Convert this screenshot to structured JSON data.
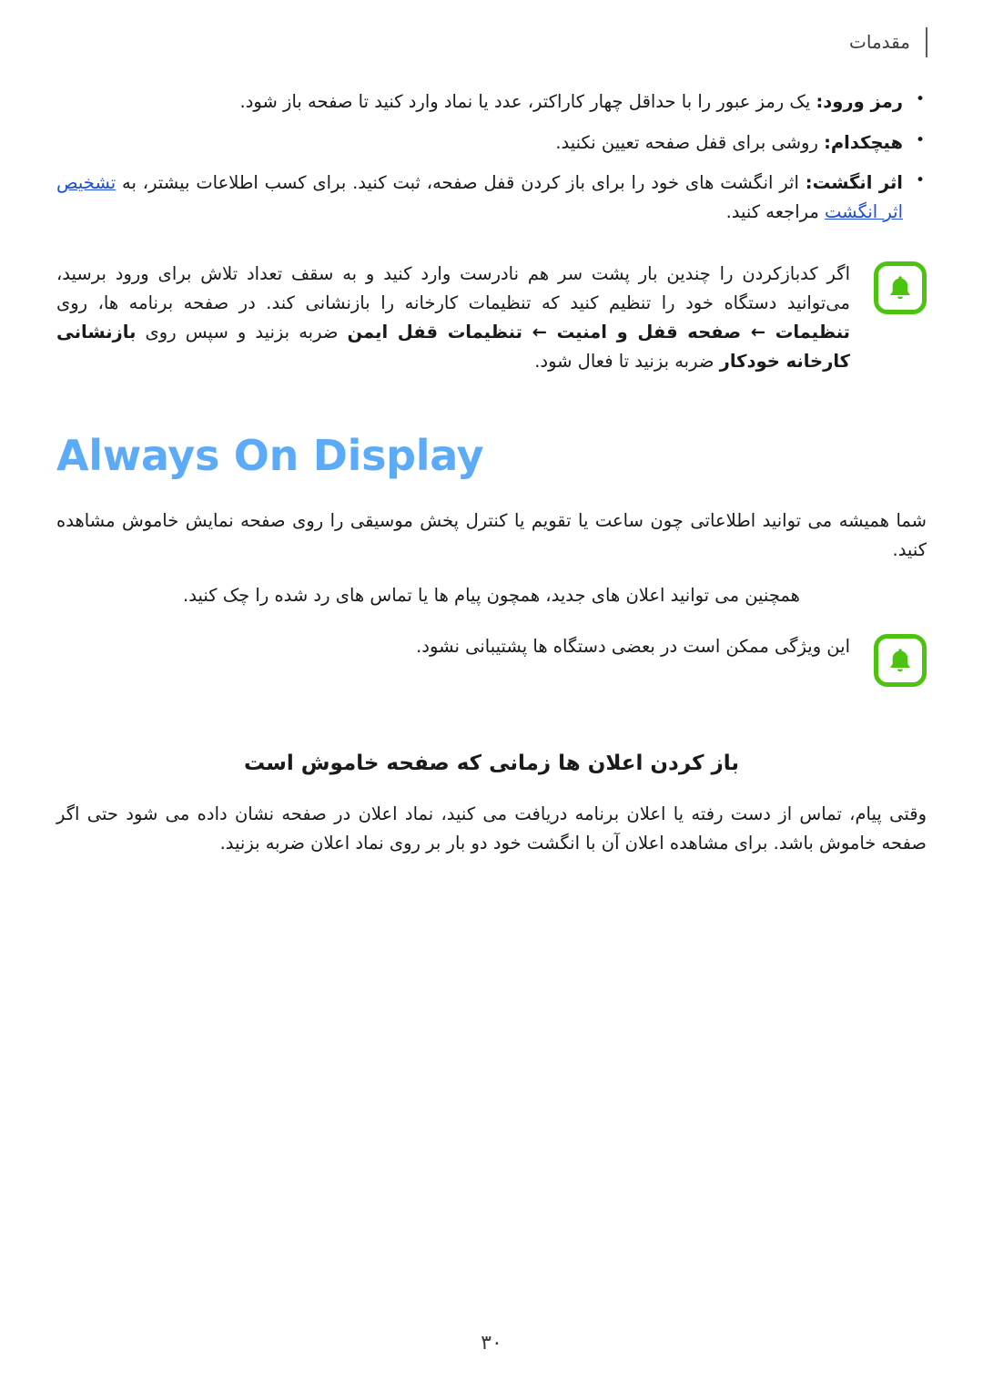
{
  "header": {
    "chapter_title": "مقدمات"
  },
  "lock_screen_bullets": [
    {
      "lead": "رمز ورود:",
      "text": " یک رمز عبور را با حداقل چهار کاراکتر، عدد یا نماد وارد کنید تا صفحه باز شود."
    },
    {
      "lead": "هیچکدام:",
      "text": " روشی برای قفل صفحه تعیین نکنید."
    },
    {
      "lead": "اثر انگشت:",
      "text": " اثر انگشت های خود را برای باز کردن قفل صفحه، ثبت کنید. برای کسب اطلاعات بیشتر، به ",
      "link_text": "تشخیص اثر انگشت",
      "text_after": " مراجعه کنید."
    }
  ],
  "notice_lock": {
    "icon": "bell-icon",
    "text_part1": "اگر کدبازکردن را چندین بار پشت سر هم نادرست وارد کنید و به سقف تعداد تلاش برای ورود برسید، می‌توانید دستگاه خود را تنظیم کنید که تنظیمات کارخانه را بازنشانی کند. در صفحه برنامه ها، روی ",
    "path_bold": "تنظیمات ← صفحه قفل و امنیت ← تنظیمات قفل ایمن",
    "text_part2": " ضربه بزنید و سپس روی ",
    "path_bold2": "بازنشانی کارخانه خودکار",
    "text_part3": " ضربه بزنید تا فعال شود."
  },
  "always_on_display": {
    "heading": "Always On Display",
    "paragraph1": "شما همیشه می توانید اطلاعاتی چون ساعت یا تقویم یا کنترل پخش موسیقی را روی صفحه نمایش خاموش مشاهده کنید.",
    "paragraph2": "همچنین می توانید اعلان های جدید، همچون پیام ها یا تماس های رد شده را چک کنید.",
    "notice": {
      "icon": "bell-icon",
      "text": "این ویژگی ممکن است در بعضی دستگاه ها پشتیبانی نشود."
    },
    "sub_heading": "باز کردن اعلان ها زمانی که صفحه خاموش است",
    "paragraph3": "وقتی پیام، تماس از دست رفته یا اعلان برنامه دریافت می کنید، نماد اعلان در صفحه نشان داده می شود حتی اگر صفحه خاموش باشد. برای مشاهده اعلان آن با انگشت خود دو بار بر روی نماد اعلان ضربه بزنید."
  },
  "footer": {
    "page_number": "۳۰"
  },
  "colors": {
    "heading_blue": "#5cabf7",
    "link_blue": "#1f4fd8",
    "notice_green": "#4cc40f",
    "header_gray": "#3b3b40",
    "rule_gray": "#5a5a60"
  }
}
